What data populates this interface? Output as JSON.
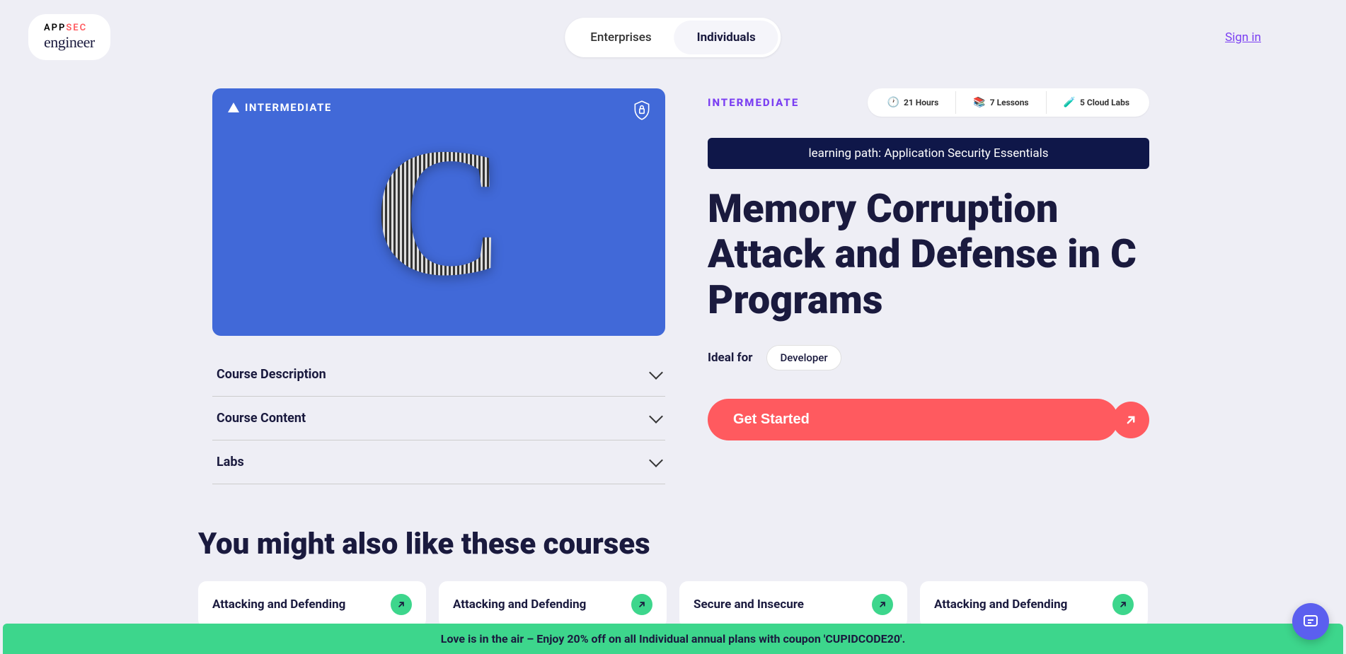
{
  "header": {
    "logo_top_app": "APP",
    "logo_top_sec": "SEC",
    "logo_bottom": "engineer",
    "nav": {
      "enterprises": "Enterprises",
      "individuals": "Individuals"
    },
    "signin": "Sign in"
  },
  "hero": {
    "badge": "INTERMEDIATE"
  },
  "accordion": {
    "items": [
      {
        "label": "Course Description"
      },
      {
        "label": "Course Content"
      },
      {
        "label": "Labs"
      }
    ]
  },
  "course": {
    "level": "INTERMEDIATE",
    "stats": {
      "hours": "21 Hours",
      "lessons": "7 Lessons",
      "labs": "5 Cloud Labs"
    },
    "path_banner": "learning path: Application Security Essentials",
    "title": "Memory Corruption Attack and Defense in C Programs",
    "ideal_label": "Ideal for",
    "ideal_role": "Developer",
    "cta": "Get Started"
  },
  "related": {
    "heading": "You might also like these courses",
    "cards": [
      {
        "title": "Attacking and Defending"
      },
      {
        "title": "Attacking and Defending"
      },
      {
        "title": "Secure and Insecure"
      },
      {
        "title": "Attacking and Defending"
      }
    ]
  },
  "promo": "Love is in the air – Enjoy 20% off on all Individual annual plans with coupon 'CUPIDCODE20'."
}
